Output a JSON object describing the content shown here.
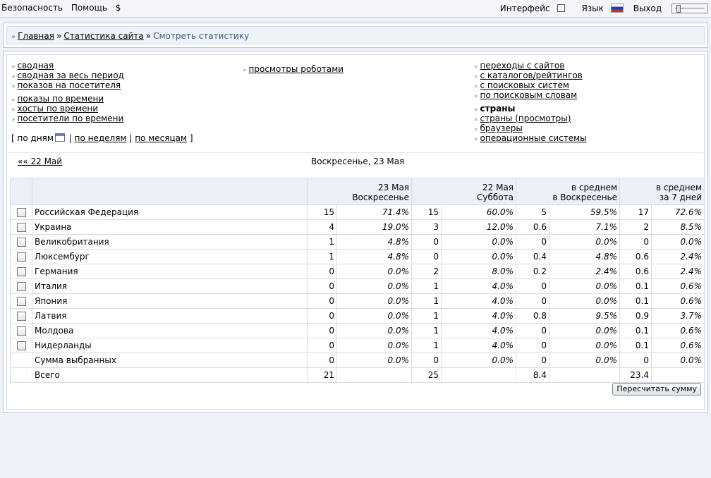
{
  "topbar": {
    "left": [
      "Безопасность",
      "Помощь",
      "$"
    ],
    "interface_label": "Интерфейс",
    "language_label": "Язык",
    "logout_label": "Выход"
  },
  "breadcrumb": {
    "home": "Главная",
    "section": "Статистика сайта",
    "current": "Смотреть статистику"
  },
  "nav": {
    "col1": [
      "сводная",
      "сводная за весь период",
      "показов на посетителя",
      "показы по времени",
      "хосты по времени",
      "посетители по времени"
    ],
    "col2": [
      "просмотры роботами"
    ],
    "col3": [
      "переходы с сайтов",
      "с каталогов/рейтингов",
      "с поисковых систем",
      "по поисковым словам",
      "страны",
      "страны (просмотры)",
      "браузеры",
      "операционные системы"
    ]
  },
  "period": {
    "open": "[",
    "by_days": "по дням",
    "by_weeks": "по неделям",
    "by_months": "по месяцам",
    "close": "]",
    "sep": "|"
  },
  "datebar": {
    "prev": "«« 22 Май",
    "current": "Воскресенье, 23 Мая"
  },
  "table": {
    "headers": [
      {
        "l1": "23 Мая",
        "l2": "Воскресенье"
      },
      {
        "l1": "22 Мая",
        "l2": "Суббота"
      },
      {
        "l1": "в среднем",
        "l2": "в Воскресенье"
      },
      {
        "l1": "в среднем",
        "l2": "за 7 дней"
      }
    ],
    "rows": [
      {
        "name": "Российская Федерация",
        "v": [
          "15",
          "71.4%",
          "15",
          "60.0%",
          "5",
          "59.5%",
          "17",
          "72.6%"
        ]
      },
      {
        "name": "Украина",
        "v": [
          "4",
          "19.0%",
          "3",
          "12.0%",
          "0.6",
          "7.1%",
          "2",
          "8.5%"
        ]
      },
      {
        "name": "Великобритания",
        "v": [
          "1",
          "4.8%",
          "0",
          "0.0%",
          "0",
          "0.0%",
          "0",
          "0.0%"
        ]
      },
      {
        "name": "Люксембург",
        "v": [
          "1",
          "4.8%",
          "0",
          "0.0%",
          "0.4",
          "4.8%",
          "0.6",
          "2.4%"
        ]
      },
      {
        "name": "Германия",
        "v": [
          "0",
          "0.0%",
          "2",
          "8.0%",
          "0.2",
          "2.4%",
          "0.6",
          "2.4%"
        ]
      },
      {
        "name": "Италия",
        "v": [
          "0",
          "0.0%",
          "1",
          "4.0%",
          "0",
          "0.0%",
          "0.1",
          "0.6%"
        ]
      },
      {
        "name": "Япония",
        "v": [
          "0",
          "0.0%",
          "1",
          "4.0%",
          "0",
          "0.0%",
          "0.1",
          "0.6%"
        ]
      },
      {
        "name": "Латвия",
        "v": [
          "0",
          "0.0%",
          "1",
          "4.0%",
          "0.8",
          "9.5%",
          "0.9",
          "3.7%"
        ]
      },
      {
        "name": "Молдова",
        "v": [
          "0",
          "0.0%",
          "1",
          "4.0%",
          "0",
          "0.0%",
          "0.1",
          "0.6%"
        ]
      },
      {
        "name": "Нидерланды",
        "v": [
          "0",
          "0.0%",
          "1",
          "4.0%",
          "0",
          "0.0%",
          "0.1",
          "0.6%"
        ]
      }
    ],
    "selected_sum": {
      "name": "Сумма выбранных",
      "v": [
        "0",
        "0.0%",
        "0",
        "0.0%",
        "0",
        "0.0%",
        "0",
        "0.0%"
      ]
    },
    "total": {
      "name": "Всего",
      "v": [
        "21",
        "",
        "25",
        "",
        "8.4",
        "",
        "23.4",
        ""
      ]
    }
  },
  "recalc_label": "Пересчитать сумму"
}
